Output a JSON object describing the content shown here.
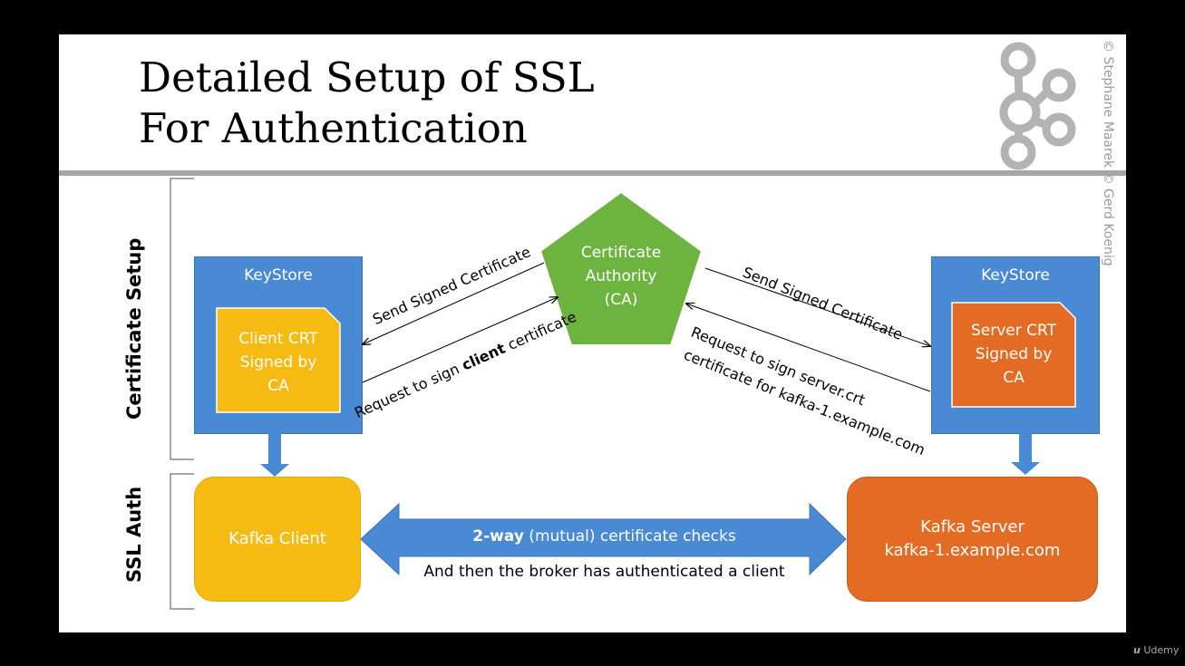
{
  "title": {
    "line1": "Detailed Setup of SSL",
    "line2": "For Authentication"
  },
  "copyright": "© Stephane Maarek © Gerd Koenig",
  "side_labels": {
    "certificate_setup": "Certificate Setup",
    "ssl_auth": "SSL Auth"
  },
  "client_keystore": {
    "label": "KeyStore",
    "crt": [
      "Client CRT",
      "Signed by",
      "CA"
    ]
  },
  "server_keystore": {
    "label": "KeyStore",
    "crt": [
      "Server CRT",
      "Signed by",
      "CA"
    ]
  },
  "ca": [
    "Certificate",
    "Authority",
    "(CA)"
  ],
  "arrows": {
    "left_send": "Send Signed Certificate",
    "left_request_pre": "Request to sign ",
    "left_request_bold": "client",
    "left_request_post": " certificate",
    "right_send": "Send Signed Certificate",
    "right_request_1": "Request to sign server.crt",
    "right_request_2": "certificate for kafka-1.example.com"
  },
  "kafka_client": "Kafka Client",
  "kafka_server": [
    "Kafka Server",
    "kafka-1.example.com"
  ],
  "mutual": {
    "bold": "2-way",
    "rest": " (mutual) certificate checks",
    "below": "And then the broker has authenticated a client"
  },
  "watermark": "Udemy",
  "colors": {
    "blue": "#4a8ad4",
    "yellow": "#f5bb13",
    "orange": "#e36b24",
    "green": "#6db33f",
    "gray": "#a6a6a6"
  }
}
